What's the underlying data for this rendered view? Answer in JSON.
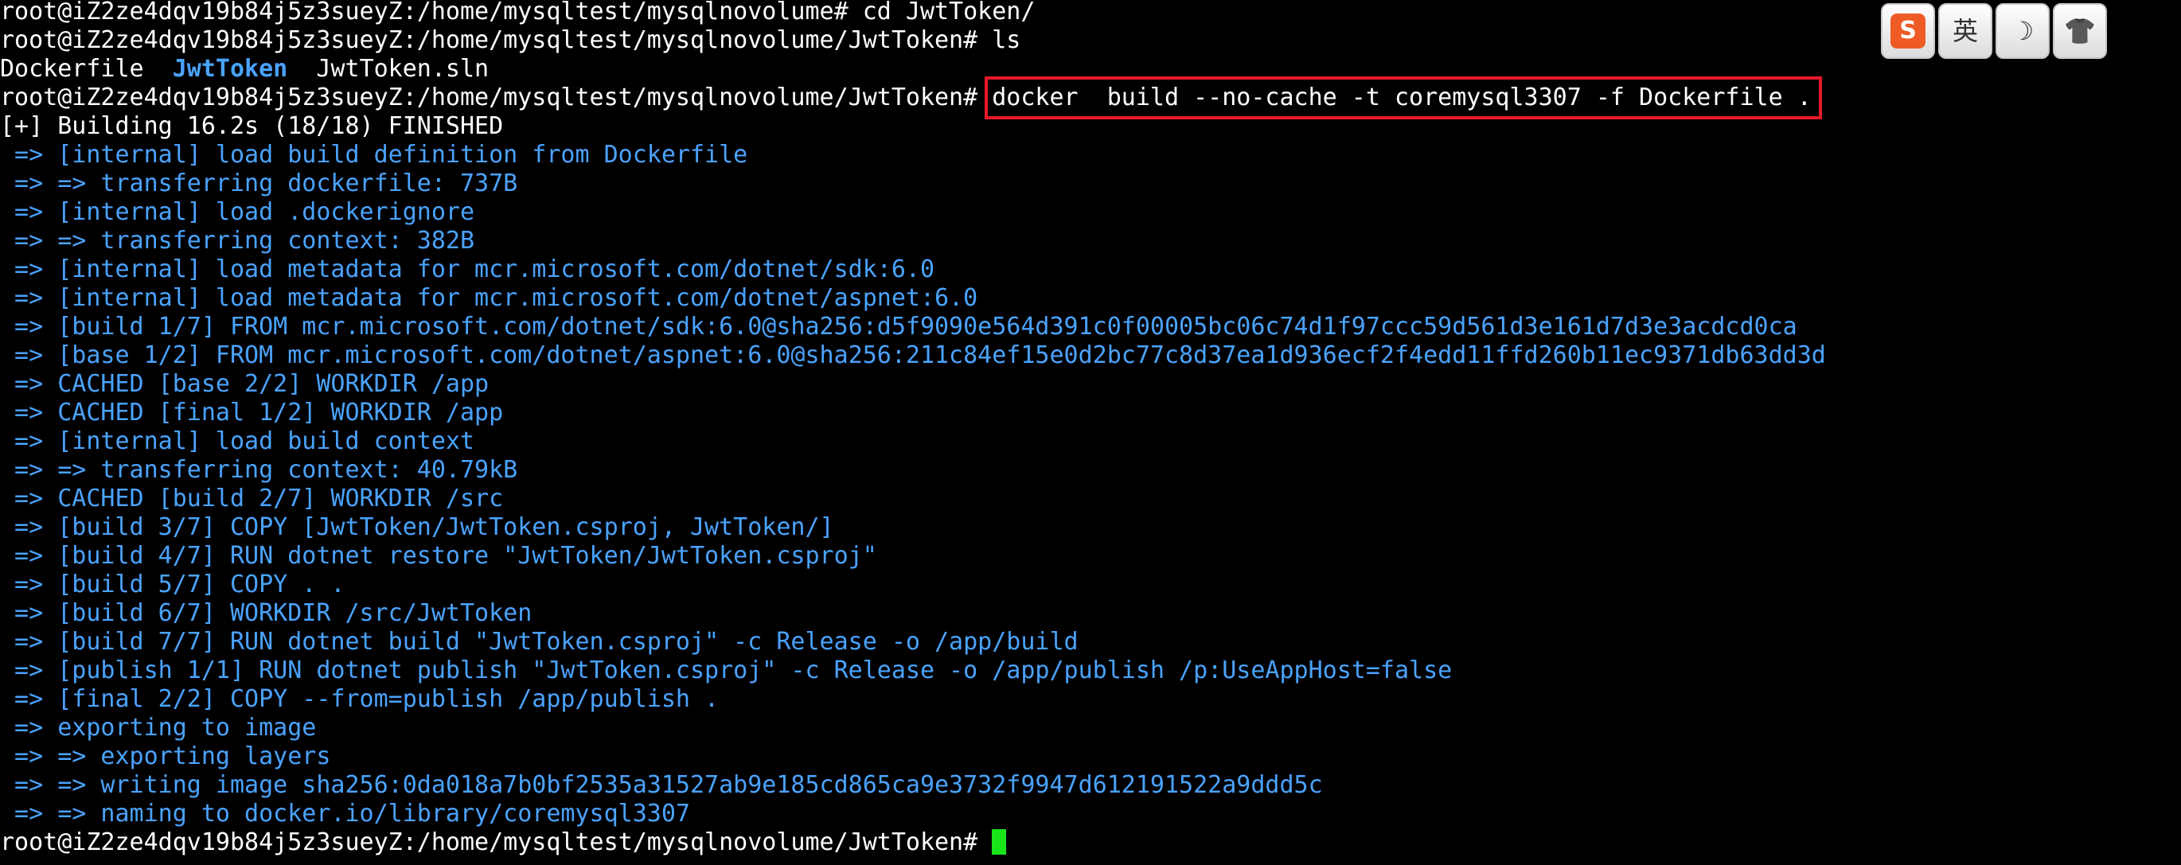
{
  "terminal": {
    "prompt": "root@iZ2ze4dqv19b84j5z3sueyZ:/home/mysqltest/mysqlnovolume/JwtToken# ",
    "line0": "root@iZ2ze4dqv19b84j5z3sueyZ:/home/mysqltest/mysqlnovolume# cd JwtToken/",
    "line1": "root@iZ2ze4dqv19b84j5z3sueyZ:/home/mysqltest/mysqlnovolume/JwtToken# ls",
    "ls_dockerfile": "Dockerfile  ",
    "ls_dir": "JwtToken",
    "ls_sln": "  JwtToken.sln",
    "command": "docker  build --no-cache -t coremysql3307 -f Dockerfile .",
    "status": "[+] Building 16.2s (18/18) FINISHED",
    "output": [
      " => [internal] load build definition from Dockerfile",
      " => => transferring dockerfile: 737B",
      " => [internal] load .dockerignore",
      " => => transferring context: 382B",
      " => [internal] load metadata for mcr.microsoft.com/dotnet/sdk:6.0",
      " => [internal] load metadata for mcr.microsoft.com/dotnet/aspnet:6.0",
      " => [build 1/7] FROM mcr.microsoft.com/dotnet/sdk:6.0@sha256:d5f9090e564d391c0f00005bc06c74d1f97ccc59d561d3e161d7d3e3acdcd0ca",
      " => [base 1/2] FROM mcr.microsoft.com/dotnet/aspnet:6.0@sha256:211c84ef15e0d2bc77c8d37ea1d936ecf2f4edd11ffd260b11ec9371db63dd3d",
      " => CACHED [base 2/2] WORKDIR /app",
      " => CACHED [final 1/2] WORKDIR /app",
      " => [internal] load build context",
      " => => transferring context: 40.79kB",
      " => CACHED [build 2/7] WORKDIR /src",
      " => [build 3/7] COPY [JwtToken/JwtToken.csproj, JwtToken/]",
      " => [build 4/7] RUN dotnet restore \"JwtToken/JwtToken.csproj\"",
      " => [build 5/7] COPY . .",
      " => [build 6/7] WORKDIR /src/JwtToken",
      " => [build 7/7] RUN dotnet build \"JwtToken.csproj\" -c Release -o /app/build",
      " => [publish 1/1] RUN dotnet publish \"JwtToken.csproj\" -c Release -o /app/publish /p:UseAppHost=false",
      " => [final 2/2] COPY --from=publish /app/publish .",
      " => exporting to image",
      " => => exporting layers",
      " => => writing image sha256:0da018a7b0bf2535a31527ab9e185cd865ca9e3732f9947d612191522a9ddd5c",
      " => => naming to docker.io/library/coremysql3307"
    ]
  },
  "ime": {
    "logo": "S",
    "lang": "英",
    "moon": "☽",
    "shirt": "👕"
  },
  "colors": {
    "background": "#000000",
    "text": "#ffffff",
    "output_blue": "#4aa3ff",
    "highlight_box": "#e8182b",
    "cursor": "#19e619"
  }
}
